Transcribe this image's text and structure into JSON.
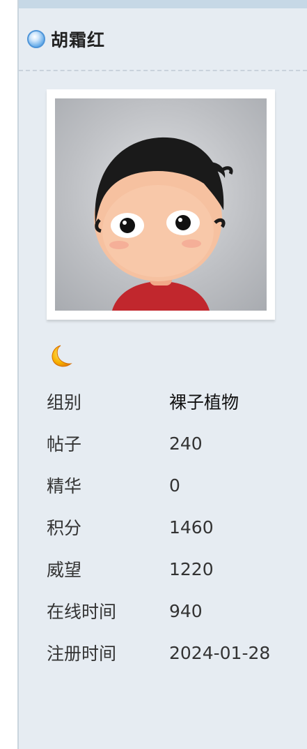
{
  "user": {
    "name": "胡霜红",
    "status_icon": "online-status-icon",
    "avatar_icon": "cartoon-boy-avatar",
    "rank_icon": "crescent-moon-icon"
  },
  "stats": [
    {
      "label": "组别",
      "value": "裸子植物"
    },
    {
      "label": "帖子",
      "value": "240"
    },
    {
      "label": "精华",
      "value": "0"
    },
    {
      "label": "积分",
      "value": "1460"
    },
    {
      "label": "威望",
      "value": "1220"
    },
    {
      "label": "在线时间",
      "value": "940"
    },
    {
      "label": "注册时间",
      "value": "2024-01-28"
    }
  ],
  "colors": {
    "panel_bg": "#e6ecf2",
    "top_strip": "#c6d8e6",
    "status_blue": "#4f95d8",
    "moon_orange": "#f5a400"
  }
}
